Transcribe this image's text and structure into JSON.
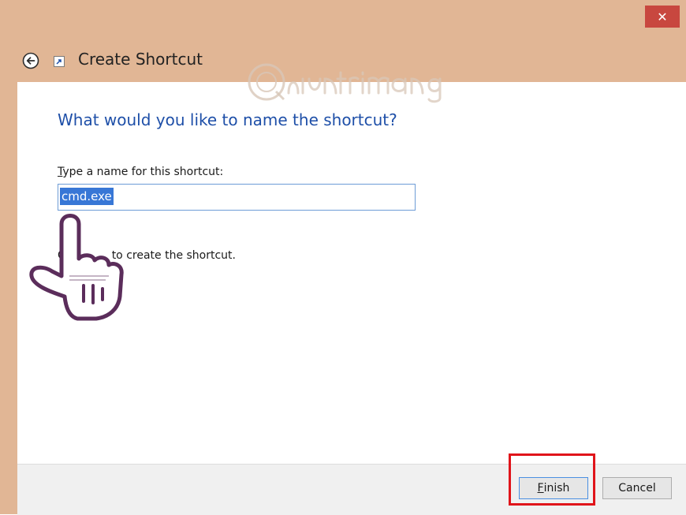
{
  "window": {
    "title": "Create Shortcut",
    "close_label": "✕"
  },
  "content": {
    "heading": "What would you like to name the shortcut?",
    "field_label_first_letter": "T",
    "field_label_rest": "ype a name for this shortcut:",
    "name_value": "cmd.exe",
    "instruction_visible_part1": "C",
    "instruction_visible_part2": "to create the shortcut."
  },
  "footer": {
    "finish_first_letter": "F",
    "finish_rest": "inish",
    "cancel_label": "Cancel"
  },
  "watermark": {
    "text": "Quantrimang"
  },
  "colors": {
    "title_bar": "#e1b695",
    "close_button": "#c8473f",
    "heading_text": "#1e4fa8",
    "selection": "#3877d6",
    "highlight_box": "#e0141a"
  }
}
